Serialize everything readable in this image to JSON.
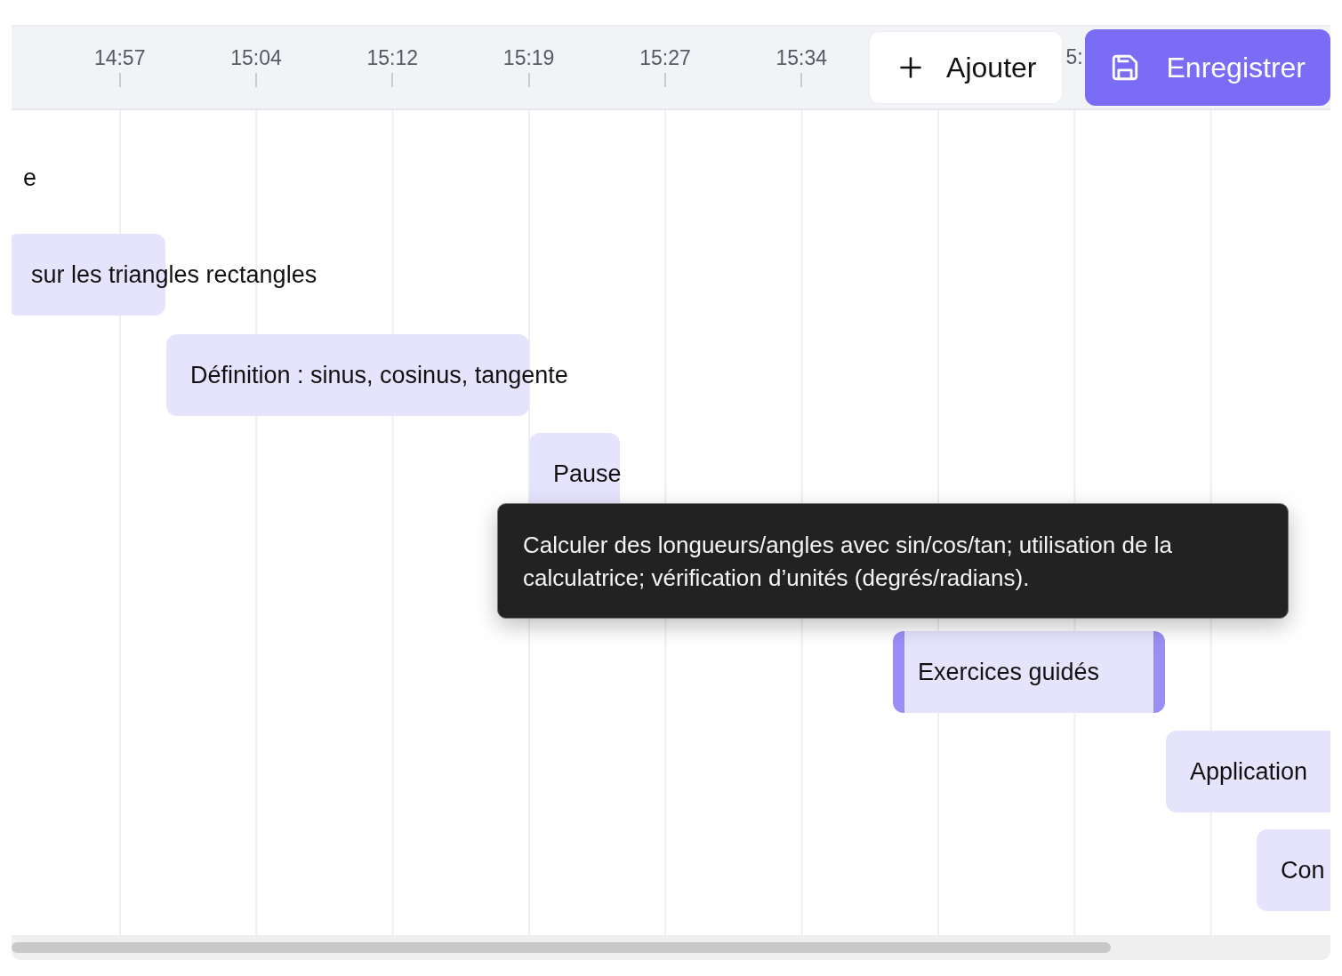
{
  "timeline": {
    "ticks": [
      "14:57",
      "15:04",
      "15:12",
      "15:19",
      "15:27",
      "15:34"
    ],
    "partial_tick": "5:",
    "actions": [
      {
        "kind": "add",
        "label": "Ajouter"
      },
      {
        "kind": "save",
        "label": "Enregistrer"
      }
    ],
    "bars": [
      {
        "label": "e"
      },
      {
        "label": "sur les triangles rectangles",
        "selected": false
      },
      {
        "label": "Définition : sinus, cosinus, tangente",
        "selected": false
      },
      {
        "label": "Pause",
        "selected": false
      },
      {
        "label": "Exercices guidés",
        "selected": true
      },
      {
        "label": "Application",
        "selected": false
      },
      {
        "label": "Con",
        "selected": false
      }
    ],
    "tooltip": "Calculer des longueurs/angles avec sin/cos/tan; utilisation de la calculatrice; vérification d’unités (degrés/radians)."
  }
}
